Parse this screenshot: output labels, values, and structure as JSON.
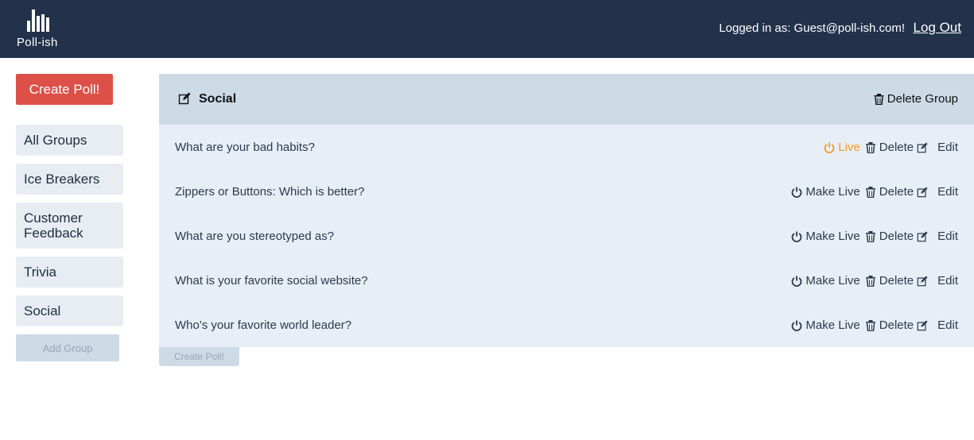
{
  "app": {
    "name": "Poll-ish"
  },
  "header": {
    "user_text": "Logged in as: Guest@poll-ish.com!",
    "logout_label": "Log Out"
  },
  "sidebar": {
    "create_label": "Create Poll!",
    "groups": [
      {
        "label": "All Groups"
      },
      {
        "label": "Ice Breakers"
      },
      {
        "label": "Customer Feedback"
      },
      {
        "label": "Trivia"
      },
      {
        "label": "Social"
      }
    ],
    "add_group_label": "Add Group"
  },
  "group": {
    "title": "Social",
    "delete_label": "Delete Group",
    "questions": [
      {
        "text": "What are your bad habits?",
        "live_label": "Live"
      },
      {
        "text": "Zippers or Buttons: Which is better?",
        "live_label": "Make Live"
      },
      {
        "text": "What are you stereotyped as?",
        "live_label": "Make Live"
      },
      {
        "text": "What is your favorite social website?",
        "live_label": "Make Live"
      },
      {
        "text": "Who's your favorite world leader?",
        "live_label": "Make Live"
      }
    ],
    "delete_label_row": "Delete",
    "edit_label_row": "Edit",
    "create_label": "Create Poll!"
  },
  "colors": {
    "header_bg": "#22324b",
    "accent_red": "#dc5047",
    "live_orange": "#f29a1d"
  },
  "icons": {
    "power": "power-icon",
    "trash": "trash-icon",
    "edit": "edit-icon"
  }
}
